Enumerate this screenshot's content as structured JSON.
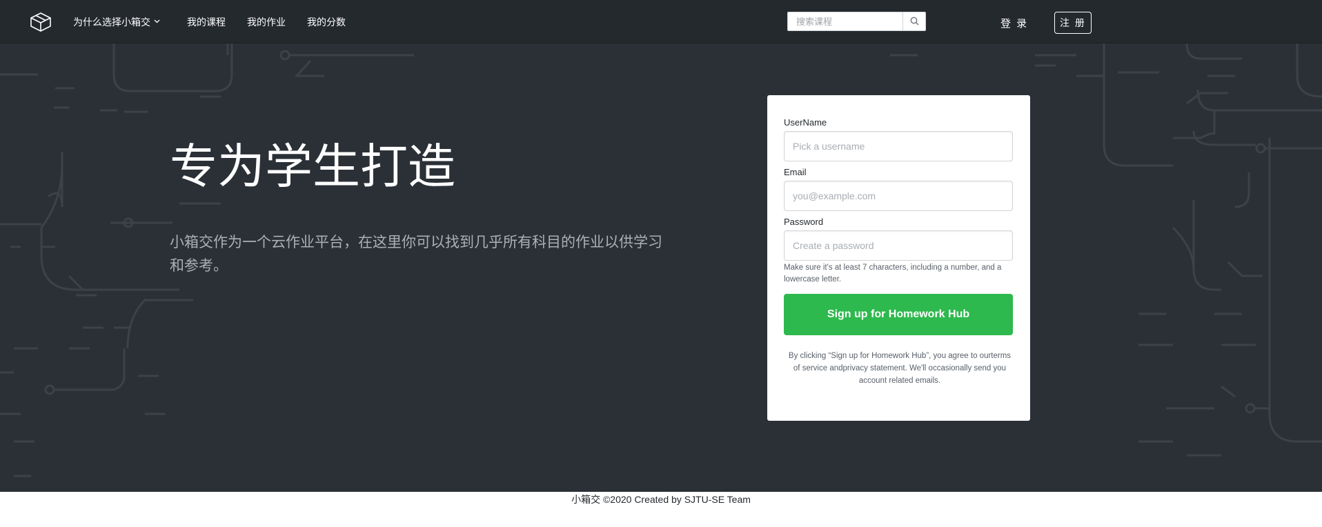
{
  "nav": {
    "items": [
      {
        "label": "为什么选择小箱交"
      },
      {
        "label": "我的课程"
      },
      {
        "label": "我的作业"
      },
      {
        "label": "我的分数"
      }
    ],
    "search_placeholder": "搜索课程",
    "login_label": "登 录",
    "register_label": "注 册"
  },
  "hero": {
    "headline": "专为学生打造",
    "subtitle": "小箱交作为一个云作业平台，在这里你可以找到几乎所有科目的作业以供学习和参考。"
  },
  "form": {
    "username_label": "UserName",
    "username_placeholder": "Pick a username",
    "email_label": "Email",
    "email_placeholder": "you@example.com",
    "password_label": "Password",
    "password_placeholder": "Create a password",
    "password_hint": "Make sure it's at least 7 characters, including a number, and a lowercase letter.",
    "submit_label": "Sign up for Homework Hub",
    "terms": "By clicking “Sign up for Homework Hub”, you agree to ourterms of service andprivacy statement. We'll occasionally send you account related emails."
  },
  "footer": {
    "text": "小箱交 ©2020 Created by SJTU-SE Team"
  },
  "colors": {
    "hero_bg": "#2b3037",
    "navbar_bg": "#24292e",
    "circuit_lines": "#3a4048",
    "signup_green": "#2db94d"
  }
}
